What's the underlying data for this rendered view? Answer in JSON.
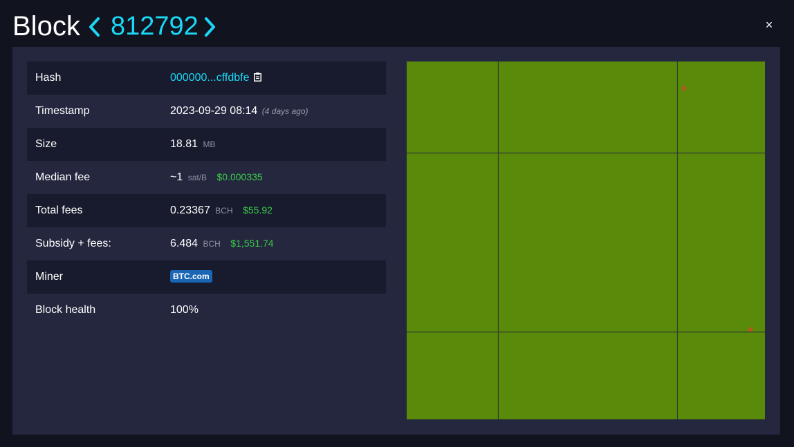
{
  "header": {
    "title": "Block",
    "height": "812792",
    "prev_icon": "chevron-left-icon",
    "next_icon": "chevron-right-icon",
    "close_label": "×"
  },
  "details": {
    "hash": {
      "label": "Hash",
      "value": "000000...cffdbfe",
      "icon": "clipboard-icon"
    },
    "timestamp": {
      "label": "Timestamp",
      "value": "2023-09-29 08:14",
      "relative": "(4 days ago)"
    },
    "size": {
      "label": "Size",
      "value": "18.81",
      "unit": "MB"
    },
    "median_fee": {
      "label": "Median fee",
      "value": "~1",
      "unit": "sat/B",
      "fiat": "$0.000335"
    },
    "total_fees": {
      "label": "Total fees",
      "value": "0.23367",
      "unit": "BCH",
      "fiat": "$55.92"
    },
    "subsidy_fees": {
      "label": "Subsidy + fees:",
      "value": "6.484",
      "unit": "BCH",
      "fiat": "$1,551.74"
    },
    "miner": {
      "label": "Miner",
      "value": "BTC.com"
    },
    "health": {
      "label": "Block health",
      "value": "100%"
    }
  },
  "block_visualization": {
    "grid_columns": 86,
    "grid_rows": 86,
    "tx_color": "#5a8a0a",
    "gap_color": "#24273e",
    "highlight_color": "#b35c1e",
    "highlighted_cells": [
      [
        66,
        6
      ],
      [
        82,
        64
      ]
    ],
    "large_tx_cells": [
      [
        79,
        0
      ],
      [
        80,
        0
      ]
    ]
  }
}
